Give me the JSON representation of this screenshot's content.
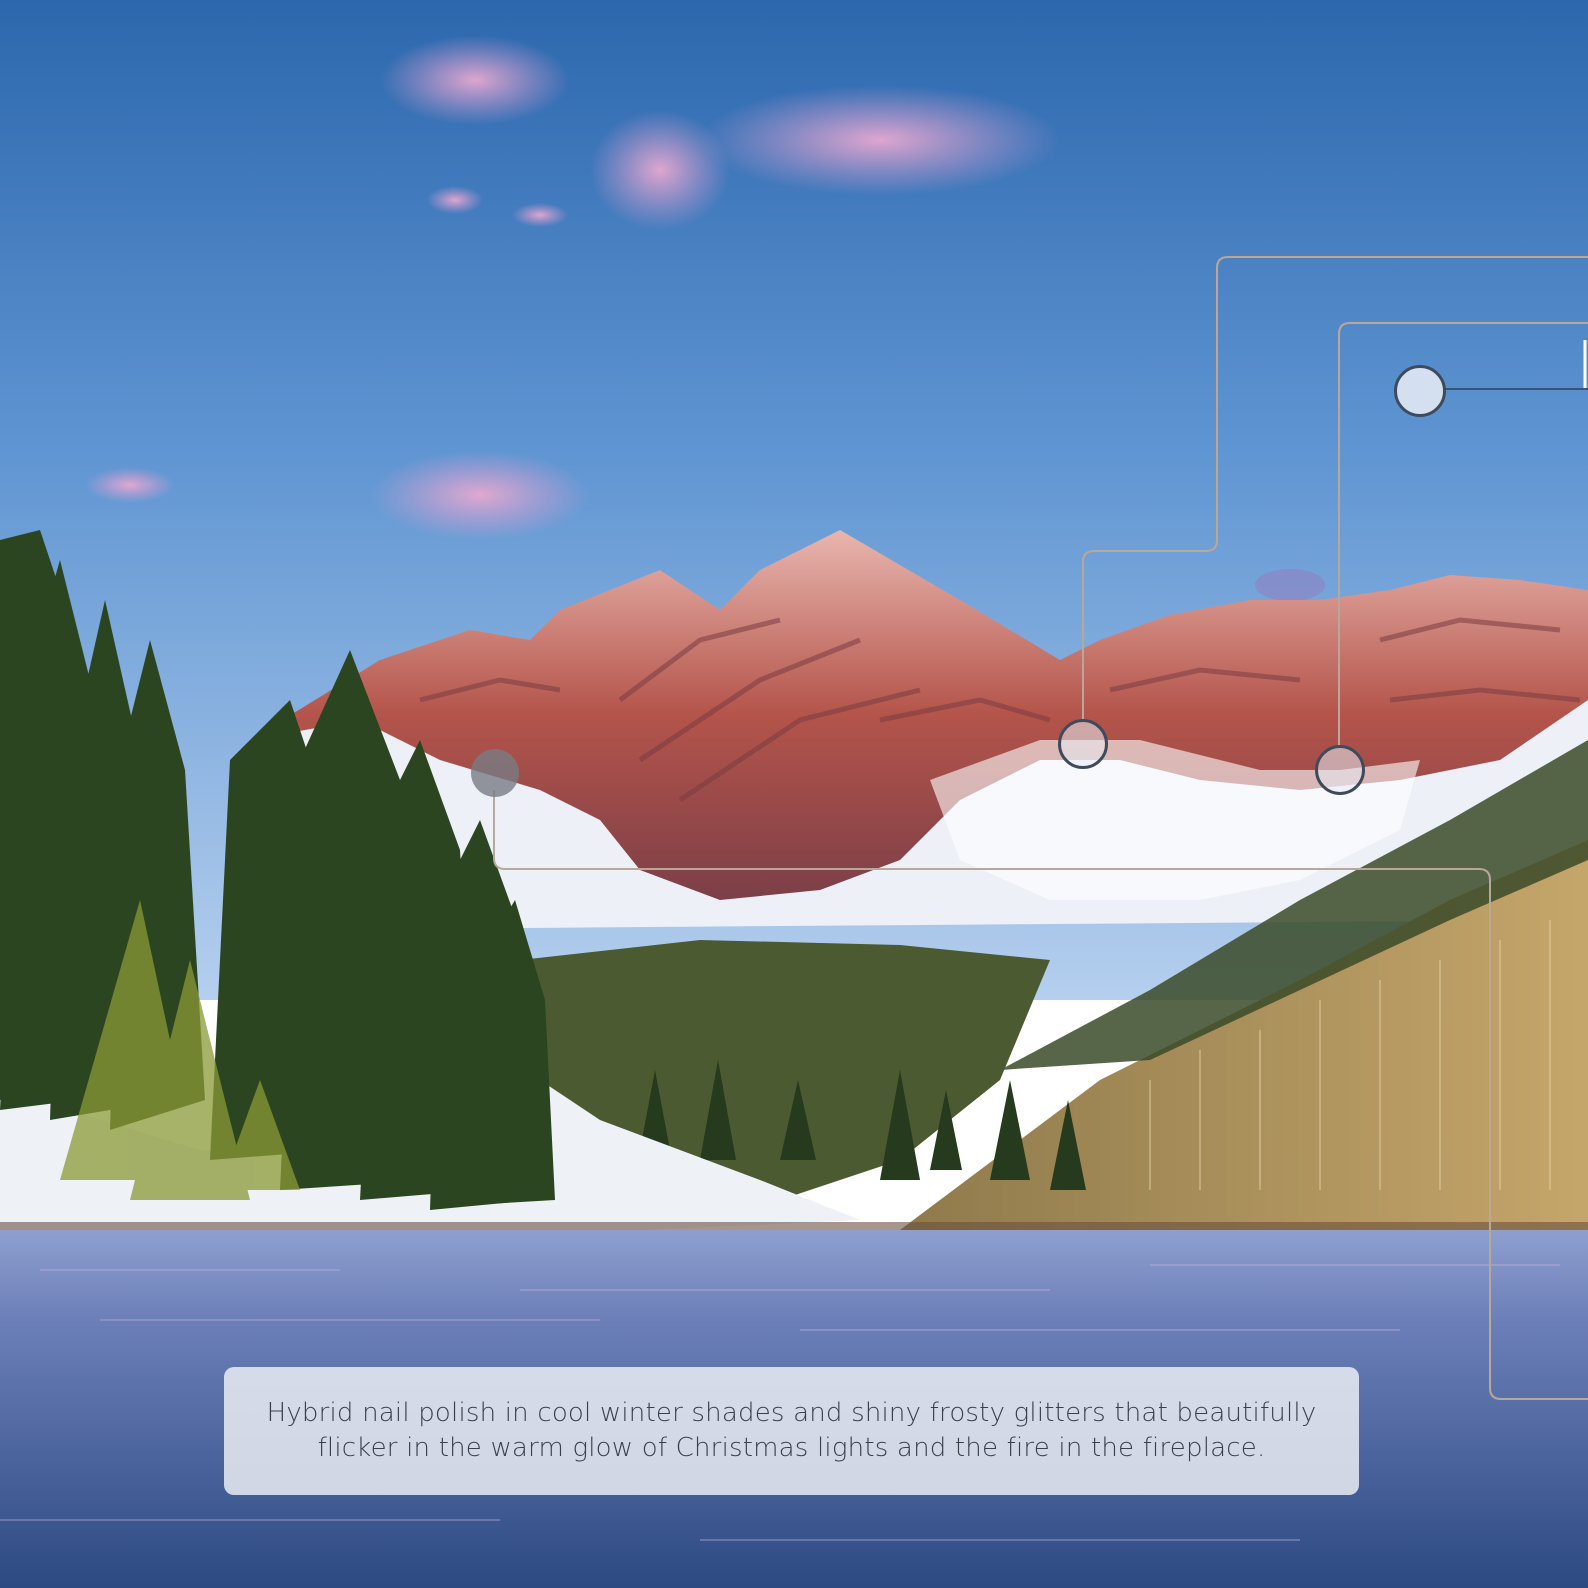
{
  "caption": {
    "text": "Hybrid nail polish in cool winter shades and shiny frosty glitters that beautifully flicker in the warm glow of Christmas lights and the fire in the fireplace."
  },
  "hotspots": [
    {
      "name": "hotspot-left-peak",
      "style": "grey"
    },
    {
      "name": "hotspot-center-valley",
      "style": "light"
    },
    {
      "name": "hotspot-right-valley",
      "style": "light"
    },
    {
      "name": "hotspot-sky",
      "style": "blue"
    }
  ],
  "colors": {
    "sky_top": "#2f6fb3",
    "sky_bottom": "#a9c8ec",
    "rock": "#b5564a",
    "snow": "#f1f2f7",
    "forest": "#2f4a24",
    "aspen": "#b89a63",
    "lake": "#4f6aa0",
    "callout_line": "#b9a79a"
  }
}
